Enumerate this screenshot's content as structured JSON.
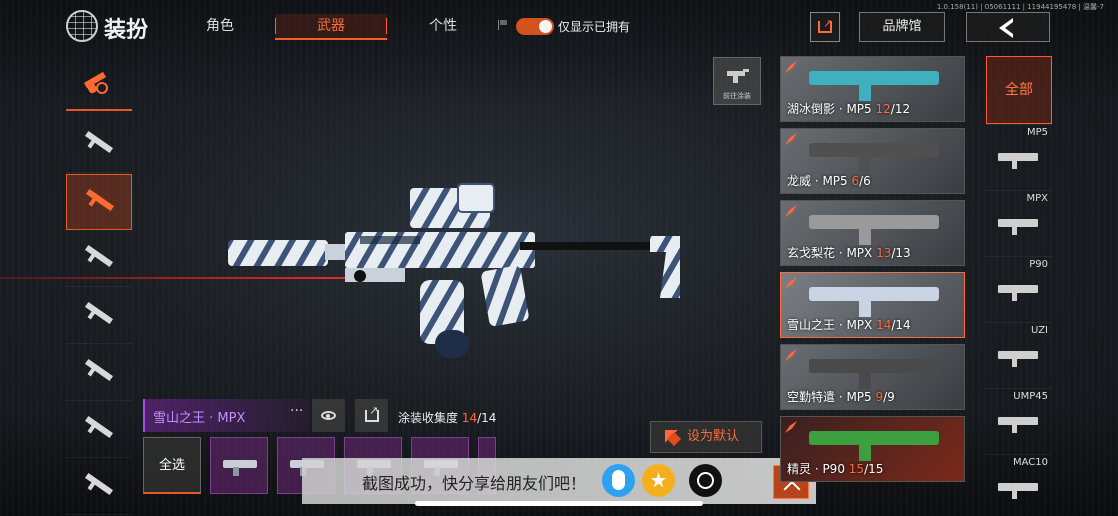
{
  "version_text": "1.0.158(11) | 05061111 | 11944195478 | 温馨-7",
  "app_title": "装扮",
  "top_tabs": [
    {
      "label": "角色"
    },
    {
      "label": "武器",
      "active": true
    },
    {
      "label": "个性"
    }
  ],
  "toggle": {
    "label": "仅显示已拥有",
    "on": true
  },
  "header_buttons": {
    "brand_label": "品牌馆"
  },
  "goto_paint_label": "前往涂装",
  "skin_info": {
    "name": "雪山之王 · MPX",
    "more": "···",
    "collect_label": "涂装收集度",
    "collect_have": "14",
    "collect_total": "/14"
  },
  "set_default_label": "设为默认",
  "select_all_label": "全选",
  "share_toast": {
    "text": "截图成功，快分享给朋友们吧！"
  },
  "skin_cards": [
    {
      "name": "湖冰倒影 · MP5",
      "have": "12",
      "total": "/12",
      "color": "#3fb0c0"
    },
    {
      "name": "龙威 · MP5",
      "have": "6",
      "total": "/6",
      "color": "#505050"
    },
    {
      "name": "玄戈梨花 · MPX",
      "have": "13",
      "total": "/13",
      "color": "#9a9a9a"
    },
    {
      "name": "雪山之王 · MPX",
      "have": "14",
      "total": "/14",
      "color": "#c8d4e4",
      "selected": true
    },
    {
      "name": "空勤特遣 · MP5",
      "have": "9",
      "total": "/9",
      "color": "#4a4a4a"
    },
    {
      "name": "精灵 · P90",
      "have": "15",
      "total": "/15",
      "color": "#3ca040"
    }
  ],
  "weapon_filter": {
    "all_label": "全部",
    "items": [
      "MP5",
      "MPX",
      "P90",
      "UZI",
      "UMP45",
      "MAC10"
    ]
  },
  "colors": {
    "accent": "#ff6b3a",
    "purple": "#a24ee0"
  }
}
